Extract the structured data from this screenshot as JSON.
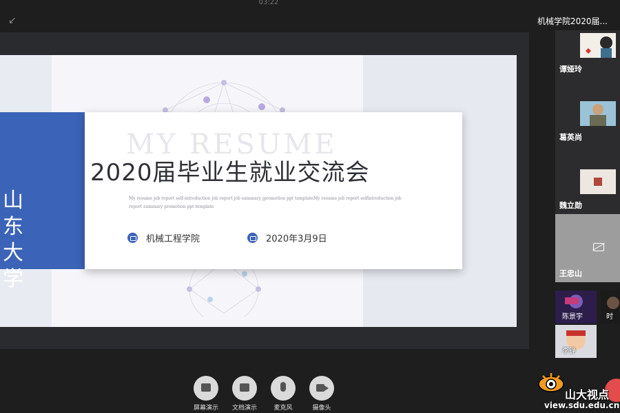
{
  "header": {
    "timer": "03:22",
    "meeting_title": "机械学院2020届..."
  },
  "slide": {
    "university": "山东大学",
    "watermark": "MY RESUME",
    "title": "2020届毕业生就业交流会",
    "subtitle": "My resume job report self-introduction job report job summary jpromotion ppt templateMy resume job report selfintroduction job report summary promotion ppt template",
    "college": "机械工程学院",
    "date": "2020年3月9日"
  },
  "participants": [
    {
      "name": "谭娅玲"
    },
    {
      "name": "葛英尚"
    },
    {
      "name": "魏立勋"
    },
    {
      "name": "王忠山"
    }
  ],
  "mini_participants": [
    {
      "name": "陈景宇"
    },
    {
      "name": "时"
    },
    {
      "name": "李铮"
    }
  ],
  "toolbar": [
    {
      "label": "屏幕演示"
    },
    {
      "label": "文档演示"
    },
    {
      "label": "麦克风"
    },
    {
      "label": "摄像头"
    }
  ],
  "logo": {
    "text": "山大视点",
    "url": "view.sdu.edu.cn"
  }
}
